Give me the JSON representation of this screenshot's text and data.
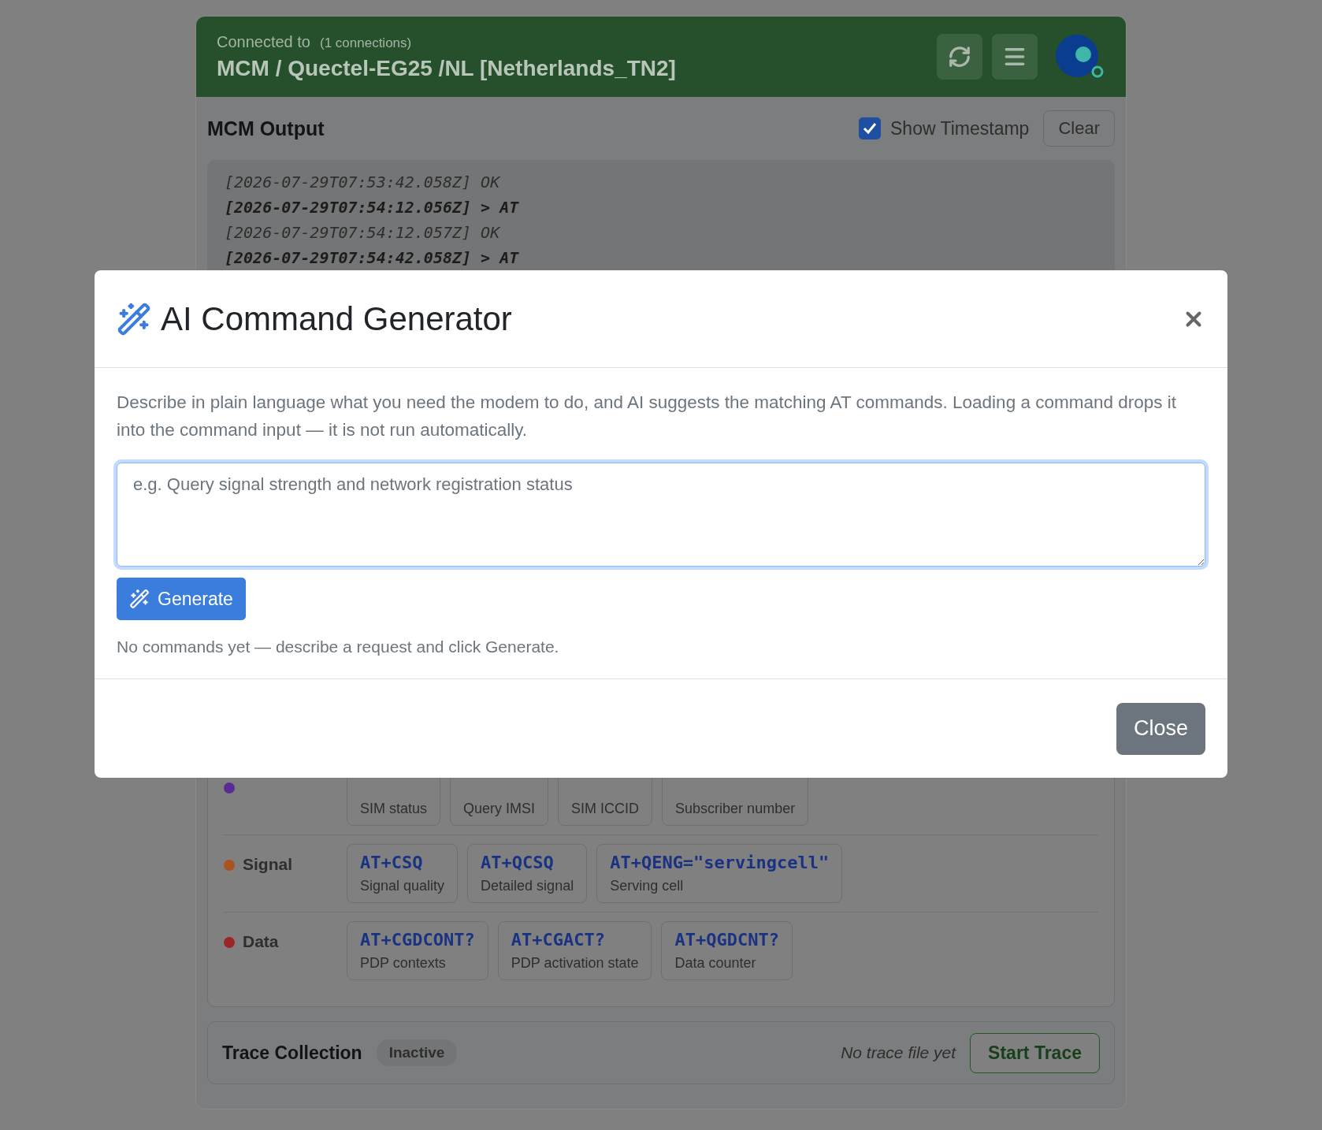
{
  "connection": {
    "label": "Connected to",
    "count": "(1 connections)",
    "title": "MCM / Quectel-EG25 /NL [Netherlands_TN2]"
  },
  "output": {
    "title": "MCM Output",
    "show_timestamp": {
      "label": "Show Timestamp",
      "checked": true
    },
    "clear_button": "Clear",
    "lines": [
      {
        "kind": "response",
        "text": "[2026-07-29T07:53:42.058Z] OK"
      },
      {
        "kind": "command",
        "text": "[2026-07-29T07:54:12.056Z] > AT"
      },
      {
        "kind": "response",
        "text": "[2026-07-29T07:54:12.057Z] OK"
      },
      {
        "kind": "command",
        "text": "[2026-07-29T07:54:42.058Z] > AT"
      }
    ]
  },
  "command_groups": [
    {
      "color": "#5a2b94",
      "commands": [
        {
          "description": "SIM status"
        },
        {
          "description": "Query IMSI"
        },
        {
          "description": "SIM ICCID"
        },
        {
          "description": "Subscriber number"
        }
      ]
    },
    {
      "name": "Signal",
      "color": "#a8541e",
      "commands": [
        {
          "code": "AT+CSQ",
          "description": "Signal quality"
        },
        {
          "code": "AT+QCSQ",
          "description": "Detailed signal"
        },
        {
          "code": "AT+QENG=\"servingcell\"",
          "description": "Serving cell"
        }
      ]
    },
    {
      "name": "Data",
      "color": "#9b2626",
      "commands": [
        {
          "code": "AT+CGDCONT?",
          "description": "PDP contexts"
        },
        {
          "code": "AT+CGACT?",
          "description": "PDP activation state"
        },
        {
          "code": "AT+QGDCNT?",
          "description": "Data counter"
        }
      ]
    }
  ],
  "trace": {
    "title": "Trace Collection",
    "status": "Inactive",
    "file_note": "No trace file yet",
    "start_button": "Start Trace"
  },
  "modal": {
    "title": "AI Command Generator",
    "description": "Describe in plain language what you need the modem to do, and AI suggests the matching AT commands. Loading a command drops it into the command input — it is not run automatically.",
    "prompt": {
      "placeholder": "e.g. Query signal strength and network registration status",
      "focused": true
    },
    "generate_button": "Generate",
    "empty_note": "No commands yet — describe a request and click Generate.",
    "close_button": "Close"
  }
}
